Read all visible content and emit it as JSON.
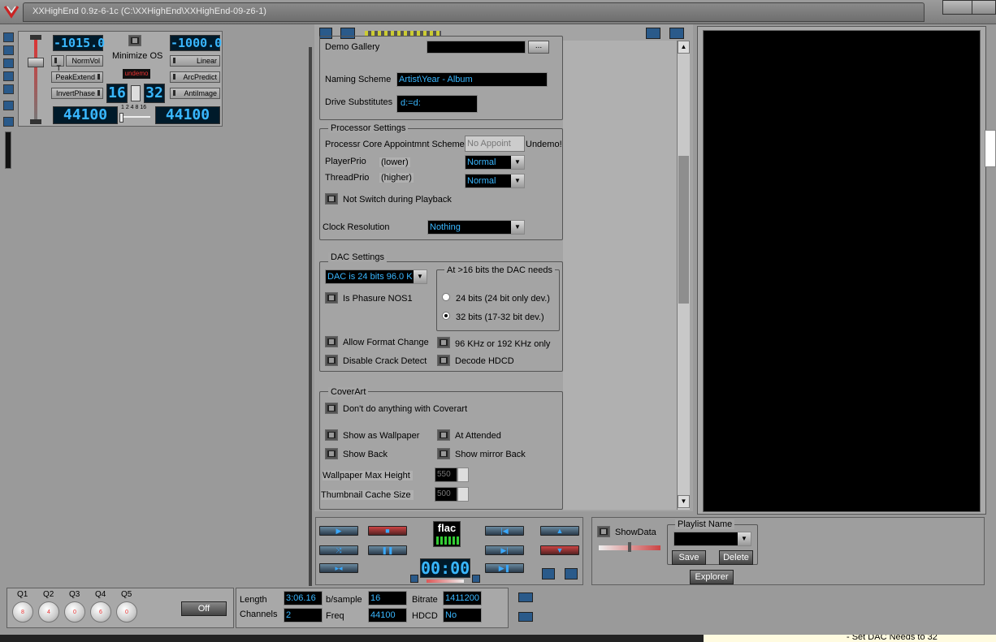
{
  "window": {
    "title": "XXHighEnd 0.9z-6-1c (C:\\XXHighEnd\\XXHighEnd-09-z6-1)"
  },
  "left_panel": {
    "lcd_top_left": "-1015.0",
    "lcd_top_right": "-1000.0",
    "minimize_os_label": "Minimize OS",
    "undemo_label": "undemo",
    "buttons_left": [
      "T",
      "NormVol",
      "PeakExtend",
      "InvertPhase"
    ],
    "buttons_right": [
      "Linear",
      "ArcPredict",
      "AntiImage"
    ],
    "bits_in": "16",
    "bits_out": "32",
    "scale_labels": "1 2 4 8 16",
    "rate_in": "44100",
    "rate_out": "44100"
  },
  "settings": {
    "demo_gallery_label": "Demo Gallery",
    "demo_gallery_value": "",
    "browse_button": "...",
    "naming_scheme_label": "Naming Scheme",
    "naming_scheme_value": "Artist\\Year - Album",
    "drive_substitutes_label": "Drive Substitutes",
    "drive_substitutes_value": "d:=d:",
    "processor": {
      "title": "Processor Settings",
      "core_label": "Processr Core Appointmnt Scheme",
      "core_value": "No Appoint",
      "undemo_label": "Undemo!",
      "playerprio_label": "PlayerPrio",
      "playerprio_hint": "(lower)",
      "playerprio_value": "Normal",
      "threadprio_label": "ThreadPrio",
      "threadprio_hint": "(higher)",
      "threadprio_value": "Normal",
      "not_switch_label": "Not Switch during Playback",
      "clock_label": "Clock Resolution",
      "clock_value": "Nothing"
    },
    "dac": {
      "title": "DAC Settings",
      "dac_value": "DAC is 24 bits   96.0 K",
      "needs_title": "At >16 bits the DAC needs",
      "opt_24": "24 bits (24 bit only dev.)",
      "opt_32": "32 bits (17-32 bit dev.)",
      "phasure_label": "Is Phasure NOS1",
      "allow_format_label": "Allow Format Change",
      "disable_crack_label": "Disable Crack Detect",
      "khz_label": "96 KHz or 192 KHz only",
      "hdcd_label": "Decode HDCD"
    },
    "coverart": {
      "title": "CoverArt",
      "dont_label": "Don't do anything with Coverart",
      "wallpaper_label": "Show as Wallpaper",
      "attended_label": "At Attended",
      "back_label": "Show Back",
      "mirror_label": "Show mirror Back",
      "wp_max_label": "Wallpaper Max Height",
      "wp_max_value": "550",
      "thumb_label": "Thumbnail Cache Size",
      "thumb_value": "500"
    }
  },
  "transport": {
    "flac_label": "flac",
    "time_display": "00:00"
  },
  "playlist": {
    "showdata_label": "ShowData",
    "playlist_name_label": "Playlist Name",
    "save_label": "Save",
    "delete_label": "Delete",
    "explorer_label": "Explorer"
  },
  "eq": {
    "labels": [
      "Q1",
      "Q2",
      "Q3",
      "Q4",
      "Q5"
    ],
    "values": [
      "8",
      "4",
      "0",
      "6",
      "0"
    ],
    "off_label": "Off"
  },
  "info": {
    "length_label": "Length",
    "length_value": "3:06.16",
    "bsample_label": "b/sample",
    "bsample_value": "16",
    "bitrate_label": "Bitrate",
    "bitrate_value": "1411200",
    "channels_label": "Channels",
    "channels_value": "2",
    "freq_label": "Freq",
    "freq_value": "44100",
    "hdcd_label": "HDCD",
    "hdcd_value": "No"
  },
  "taskbar_text": "- Set DAC Needs to 32",
  "colors": {
    "lcd_text": "#39b7ff",
    "background": "#9a9a9a",
    "accent_red": "#e33"
  }
}
